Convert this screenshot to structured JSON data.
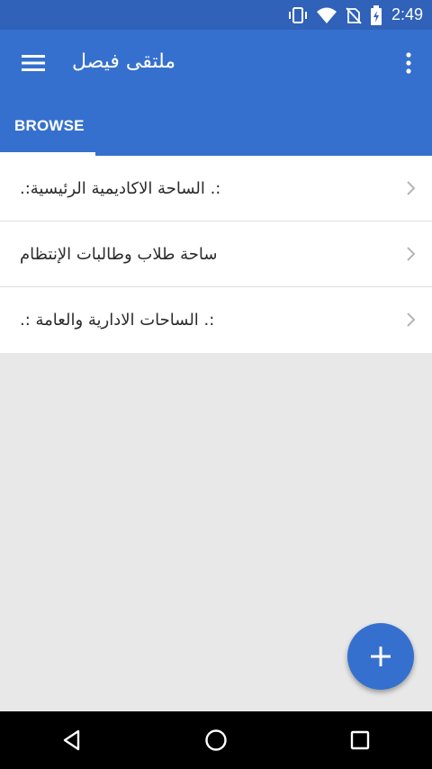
{
  "status_bar": {
    "time": "2:49",
    "icons": [
      "vibrate-icon",
      "wifi-icon",
      "no-sim-icon",
      "battery-charging-icon"
    ]
  },
  "app_bar": {
    "title": "ملتقى فيصل",
    "menu_icon": "hamburger-menu-icon",
    "overflow_icon": "more-vert-icon",
    "color": "#3670ce"
  },
  "tabs": [
    {
      "label": "BROWSE",
      "selected": true
    }
  ],
  "forum_list": [
    {
      "label": ":. الساحة الاكاديمية  الرئيسية:."
    },
    {
      "label": "ساحة طلاب وطالبات الإنتظام"
    },
    {
      "label": ":. الساحات الادارية والعامة :."
    }
  ],
  "fab": {
    "icon": "plus-icon"
  },
  "nav_bar": {
    "icons": [
      "back-icon",
      "home-icon",
      "recents-icon"
    ]
  }
}
